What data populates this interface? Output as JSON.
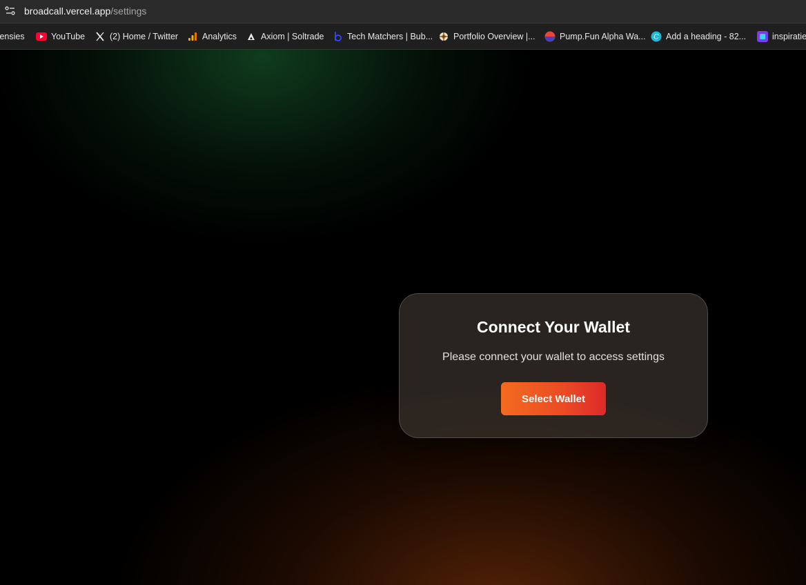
{
  "browser": {
    "url_host": "broadcall.vercel.app",
    "url_path": "/settings",
    "bookmarks": [
      {
        "label": "tensies",
        "icon": "none"
      },
      {
        "label": "YouTube",
        "icon": "youtube-icon"
      },
      {
        "label": "(2) Home / Twitter",
        "icon": "x-twitter-icon"
      },
      {
        "label": "Analytics",
        "icon": "analytics-icon"
      },
      {
        "label": "Axiom | Soltrade",
        "icon": "axiom-icon"
      },
      {
        "label": "Tech Matchers | Bub...",
        "icon": "bubble-icon"
      },
      {
        "label": "Portfolio Overview |...",
        "icon": "portfolio-icon"
      },
      {
        "label": "Pump.Fun Alpha Wa...",
        "icon": "pumpfun-icon"
      },
      {
        "label": "Add a heading - 82...",
        "icon": "canva-icon"
      },
      {
        "label": "inspiratie",
        "icon": "inspiratie-icon"
      }
    ]
  },
  "modal": {
    "title": "Connect Your Wallet",
    "message": "Please connect your wallet to access settings",
    "button_label": "Select Wallet"
  },
  "colors": {
    "button_gradient_start": "#f46b1f",
    "button_gradient_end": "#dc2a2a",
    "bg_green_glow": "#124623",
    "bg_orange_glow": "#6e2d08"
  }
}
